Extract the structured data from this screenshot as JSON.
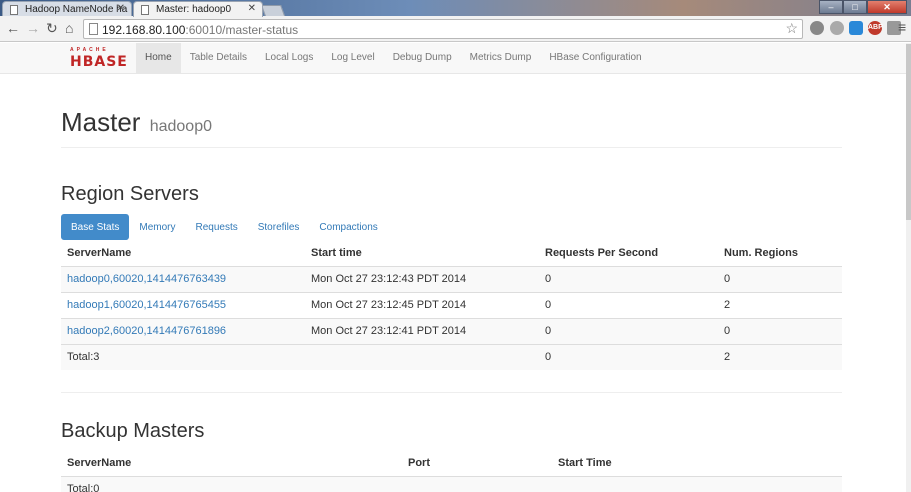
{
  "browser": {
    "tabs": [
      {
        "title": "Hadoop NameNode ha",
        "active": false
      },
      {
        "title": "Master: hadoop0",
        "active": true
      }
    ],
    "url_host": "192.168.80.100",
    "url_path": ":60010/master-status",
    "ext_abp": "ABP"
  },
  "navbar": {
    "logo_apache": "APACHE",
    "logo_hbase": "HBASE",
    "links": [
      "Home",
      "Table Details",
      "Local Logs",
      "Log Level",
      "Debug Dump",
      "Metrics Dump",
      "HBase Configuration"
    ],
    "active_link": "Home"
  },
  "header": {
    "title": "Master",
    "subtitle": "hadoop0"
  },
  "region_servers": {
    "heading": "Region Servers",
    "tabs": [
      "Base Stats",
      "Memory",
      "Requests",
      "Storefiles",
      "Compactions"
    ],
    "active_tab": "Base Stats",
    "columns": [
      "ServerName",
      "Start time",
      "Requests Per Second",
      "Num. Regions"
    ],
    "rows": [
      [
        "hadoop0,60020,1414476763439",
        "Mon Oct 27 23:12:43 PDT 2014",
        "0",
        "0"
      ],
      [
        "hadoop1,60020,1414476765455",
        "Mon Oct 27 23:12:45 PDT 2014",
        "0",
        "2"
      ],
      [
        "hadoop2,60020,1414476761896",
        "Mon Oct 27 23:12:41 PDT 2014",
        "0",
        "0"
      ]
    ],
    "total": [
      "Total:3",
      "",
      "0",
      "2"
    ]
  },
  "backup_masters": {
    "heading": "Backup Masters",
    "columns": [
      "ServerName",
      "Port",
      "Start Time"
    ],
    "total": "Total:0"
  }
}
